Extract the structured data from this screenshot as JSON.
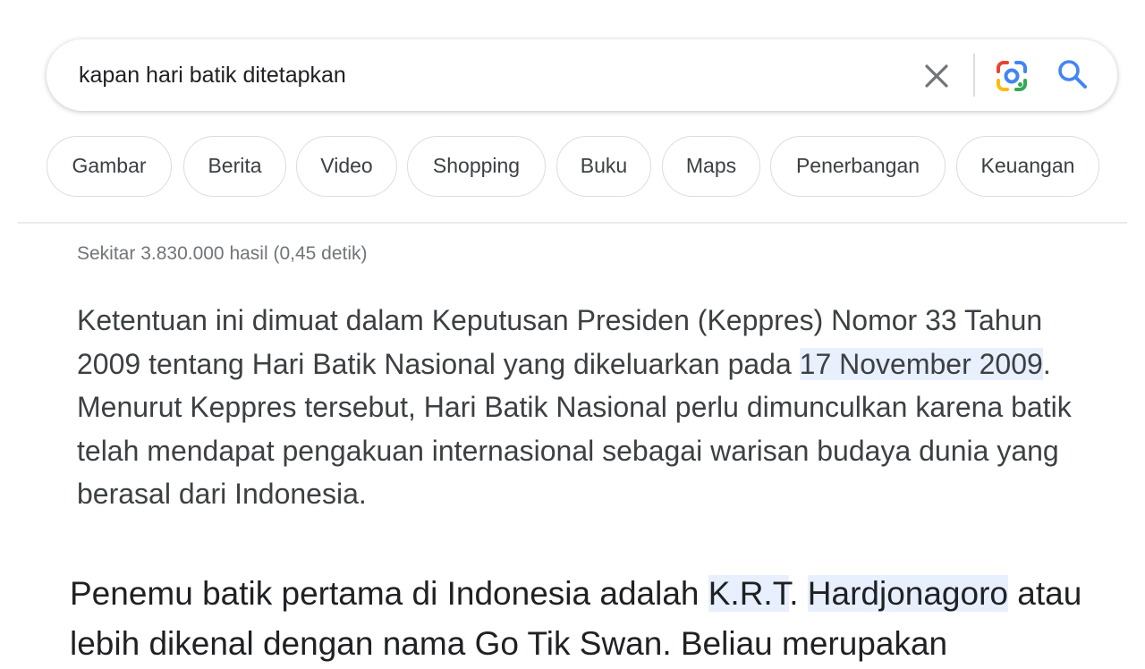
{
  "search": {
    "query": "kapan hari batik ditetapkan"
  },
  "chips": [
    "Gambar",
    "Berita",
    "Video",
    "Shopping",
    "Buku",
    "Maps",
    "Penerbangan",
    "Keuangan"
  ],
  "results": {
    "stats": "Sekitar 3.830.000 hasil (0,45 detik)",
    "snippet": {
      "part1": "Ketentuan ini dimuat dalam Keputusan Presiden (Keppres) Nomor 33 Tahun 2009 tentang Hari Batik Nasional yang dikeluarkan pada ",
      "highlight": "17 November 2009",
      "part2": ". Menurut Keppres tersebut, Hari Batik Nasional perlu dimunculkan karena batik telah mendapat pengakuan internasional sebagai warisan budaya dunia yang berasal dari Indonesia."
    },
    "snippet2": {
      "part1": "Penemu batik pertama di Indonesia adalah ",
      "highlight1": "K.R.T",
      "sep": ". ",
      "highlight2": "Hardjonagoro",
      "part2": " atau lebih dikenal dengan nama Go Tik Swan. Beliau merupakan"
    }
  },
  "colors": {
    "lens_blue": "#4285f4",
    "lens_red": "#ea4335",
    "lens_yellow": "#fbbc04",
    "lens_green": "#34a853",
    "search_icon": "#4285f4",
    "highlight_bg": "#e8f0fe"
  },
  "icons": {
    "clear": "close-icon",
    "lens": "google-lens-icon",
    "search": "search-icon"
  }
}
